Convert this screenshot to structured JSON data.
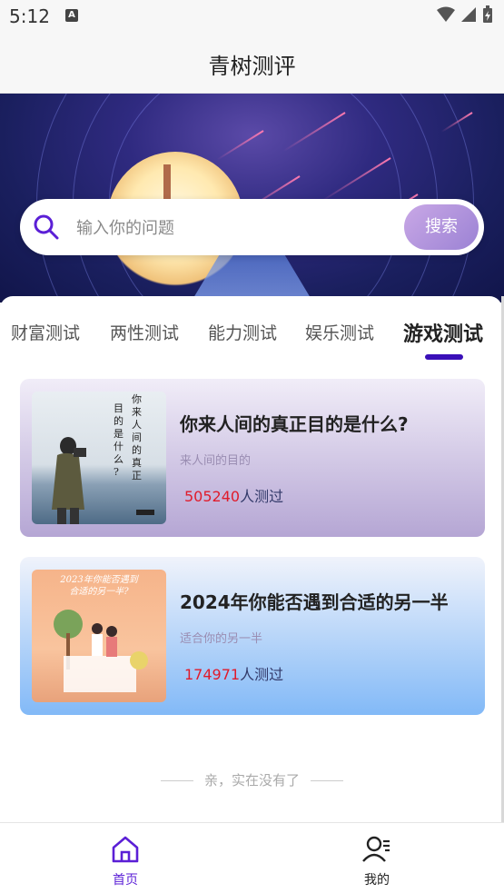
{
  "status": {
    "time": "5:12"
  },
  "header": {
    "title": "青树测评"
  },
  "search": {
    "placeholder": "输入你的问题",
    "button": "搜索"
  },
  "tabs": [
    {
      "label": "财富测试",
      "active": false
    },
    {
      "label": "两性测试",
      "active": false
    },
    {
      "label": "能力测试",
      "active": false
    },
    {
      "label": "娱乐测试",
      "active": false
    },
    {
      "label": "游戏测试",
      "active": true
    }
  ],
  "cards": [
    {
      "title": "你来人间的真正目的是什么?",
      "subtitle": "来人间的目的",
      "count": "505240",
      "count_suffix": "人测过",
      "thumb_text": "你来人间的真正目的是什么?"
    },
    {
      "title": "2024年你能否遇到合适的另一半",
      "subtitle": "适合你的另一半",
      "count": "174971",
      "count_suffix": "人测过",
      "thumb_text": "2023年你能否遇到合适的另一半?"
    }
  ],
  "footer_note": "亲，实在没有了",
  "tabbar": {
    "home": "首页",
    "mine": "我的"
  },
  "colors": {
    "accent": "#5b1fd6",
    "count": "#e01b2b",
    "tab_underline": "#3a10b8"
  }
}
